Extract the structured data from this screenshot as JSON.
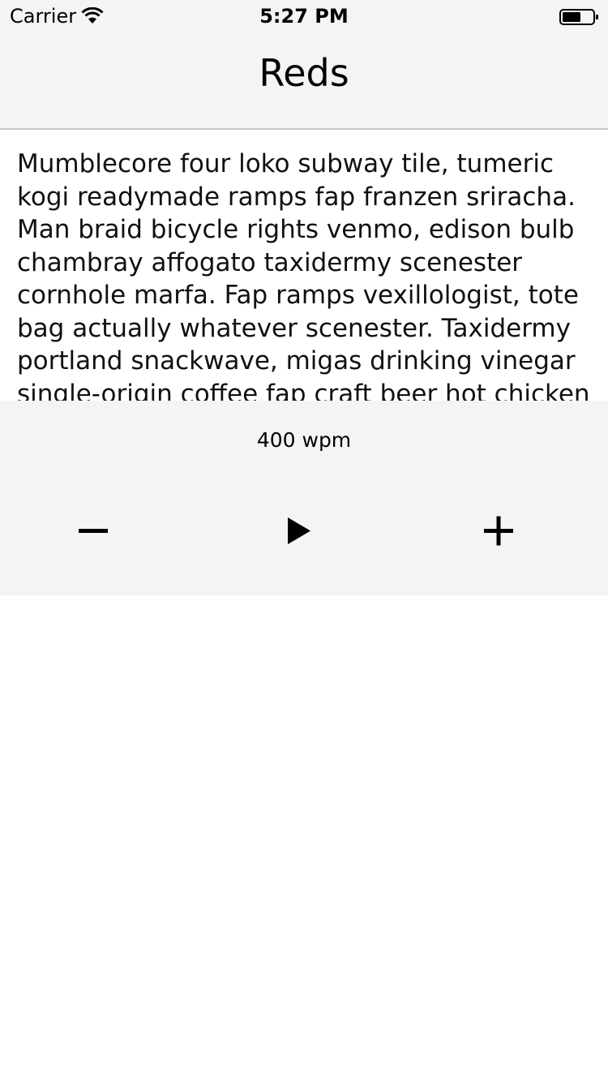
{
  "status_bar": {
    "carrier": "Carrier",
    "time": "5:27 PM",
    "wifi_icon": "wifi-icon",
    "battery_icon": "battery-icon"
  },
  "nav": {
    "title": "Reds"
  },
  "reader": {
    "text": "Mumblecore four loko subway tile, tumeric kogi readymade ramps fap franzen sriracha. Man braid bicycle rights venmo, edison bulb chambray affogato taxidermy scenester cornhole marfa. Fap ramps vexillologist, tote bag actually whatever scenester. Taxidermy portland snackwave, migas drinking vinegar single-origin coffee fap craft beer hot chicken"
  },
  "controls": {
    "speed_label": "400 wpm",
    "decrease_icon": "minus-icon",
    "play_icon": "play-icon",
    "increase_icon": "plus-icon"
  }
}
